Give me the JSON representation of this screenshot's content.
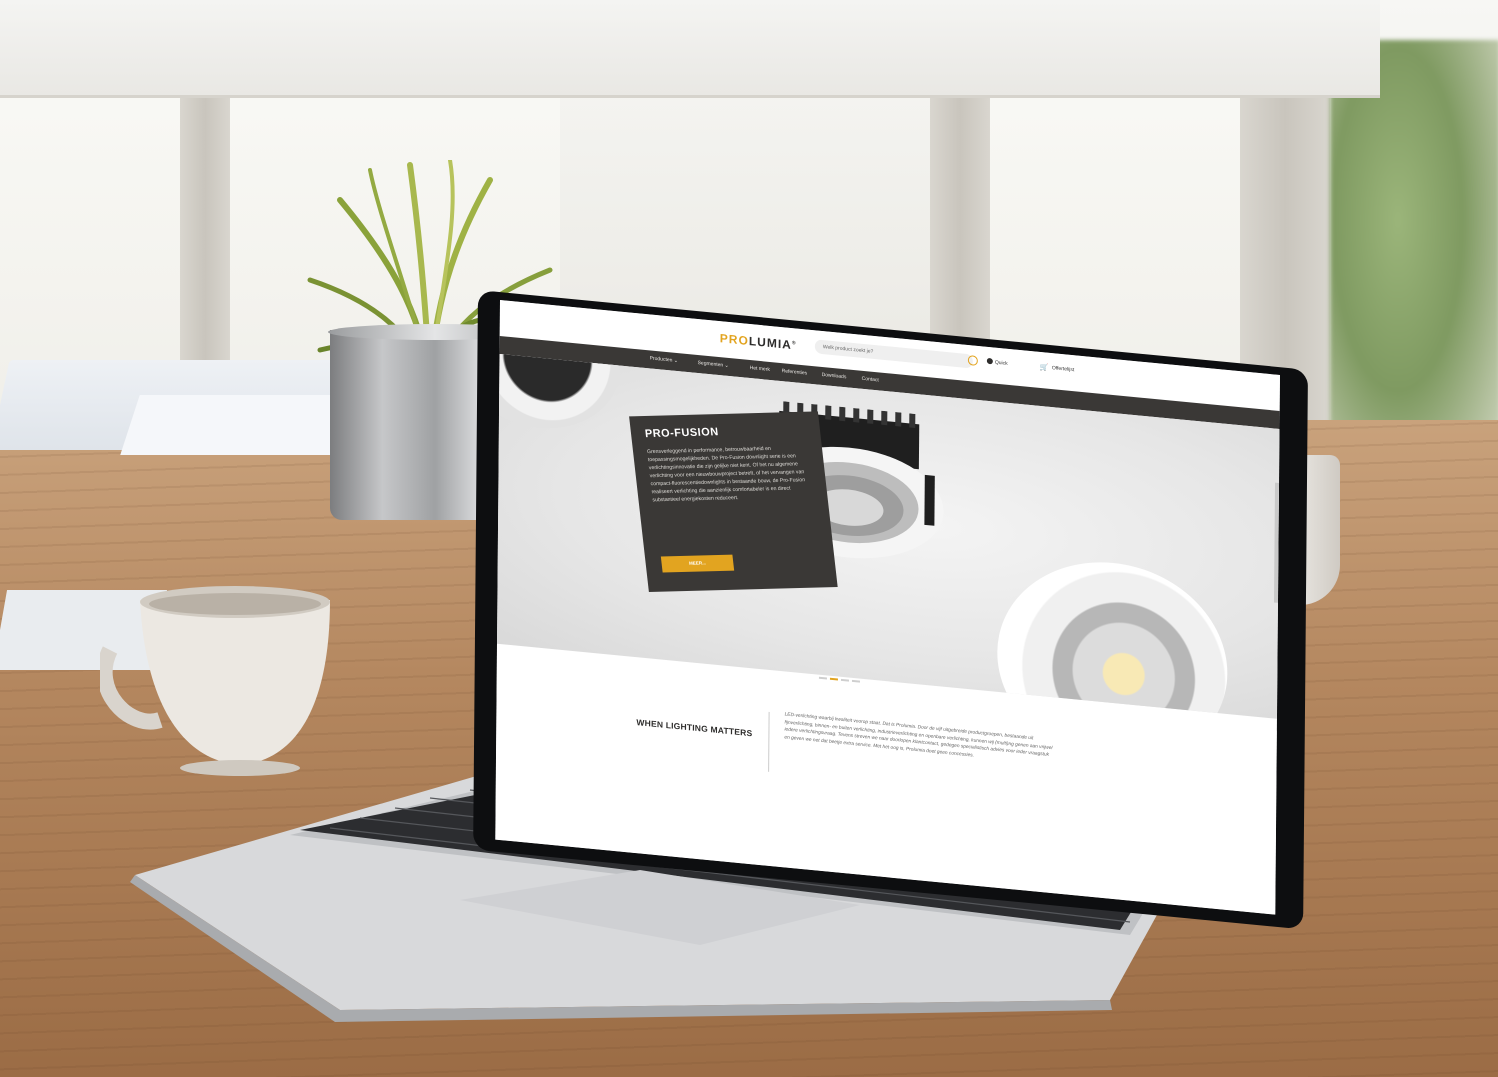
{
  "site": {
    "logo_pro": "PRO",
    "logo_lumia": "LUMIA",
    "logo_mark": "®",
    "search_placeholder": "Welk product zoekt je?",
    "quick_label": "Quick",
    "cart_label": "Offertelijst"
  },
  "nav": {
    "items": [
      {
        "label": "Producten  ⌄"
      },
      {
        "label": "Segmenten  ⌄"
      },
      {
        "label": "Het merk"
      },
      {
        "label": "Referenties"
      },
      {
        "label": "Downloads"
      },
      {
        "label": "Contact"
      }
    ]
  },
  "hero": {
    "title": "PRO-FUSION",
    "text": "Grensverleggend in performance, betrouwbaarheid en toepassingsmogelijkheden. De Pro-Fusion downlight serie is een verlichtingsinnovatie die zijn gelijke niet kent. Of het nu algemene verlichting voor een nieuwbouwproject betreft, of het vervangen van compact-fluorescentiedownlights in bestaande bouw, de Pro-Fusion realiseert verlichting die aanzienlijk comfortabeler is en direct substantieel energiekosten reduceert.",
    "button_label": "MEER..."
  },
  "slider": {
    "active_index": 1,
    "count": 4
  },
  "about": {
    "tagline": "WHEN LIGHTING MATTERS",
    "text": "LED-verlichting waarbij kwaliteit voorop staat. Dat is Prolumia. Door de vijf uitgebreide productgroepen, bestaande uit fijnverlichting, binnen- en buiten verlichting, industrieverlichting en openbare verlichting, kunnen wij (multi)ng genen aan vrijwel iedere verlichtingsvraag. Tevens streven we naar doorlopen klantcontact, gedegen specialistisch advies voor ieder vraagstuk en geven we net dat beetje extra service. Met het oog is, Prolumia doet geen concessies."
  },
  "colors": {
    "accent": "#e2a420",
    "dark": "#3a3836",
    "text": "#2e2d2c"
  }
}
